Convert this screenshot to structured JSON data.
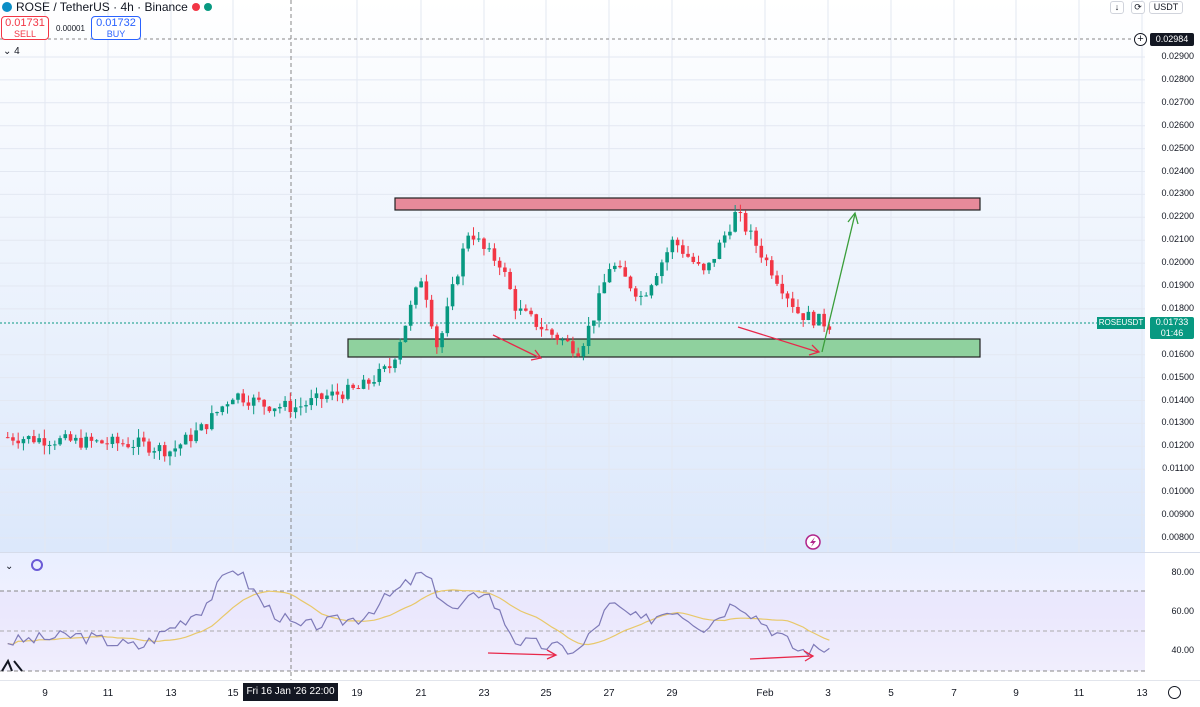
{
  "header": {
    "symbol": "ROSE / TetherUS · 4h · Binance",
    "sell_price": "0.01731",
    "sell_label": "SELL",
    "buy_price": "0.01732",
    "buy_label": "BUY",
    "spread": "0.00001",
    "indicator_count": "4",
    "currency_button": "USDT"
  },
  "price_axis": {
    "labels": [
      "0.02900",
      "0.02800",
      "0.02700",
      "0.02600",
      "0.02500",
      "0.02400",
      "0.02300",
      "0.02200",
      "0.02100",
      "0.02000",
      "0.01900",
      "0.01800",
      "0.01600",
      "0.01500",
      "0.01400",
      "0.01300",
      "0.01200",
      "0.01100",
      "0.01000",
      "0.00900",
      "0.00800"
    ],
    "top_price_tag": "0.02984",
    "last_price": "0.01733",
    "countdown": "01:46",
    "symbol_tag": "ROSEUSDT"
  },
  "rsi_axis": {
    "labels": [
      "80.00",
      "60.00",
      "40.00"
    ]
  },
  "time_axis": {
    "labels": [
      "9",
      "11",
      "13",
      "15",
      "19",
      "21",
      "23",
      "25",
      "27",
      "29",
      "Feb",
      "3",
      "5",
      "7",
      "9",
      "11",
      "13"
    ],
    "crosshair_label": "Fri 16 Jan '26   22:00"
  },
  "colors": {
    "up": "#089981",
    "down": "#f23645",
    "resistance_zone": "#e88a9a",
    "support_zone": "#8fd19e",
    "rsi_line": "#7e7ab8",
    "rsi_ma": "#e8c86a",
    "arrow_red": "#e8284a",
    "arrow_green": "#3a9e3a"
  },
  "chart_data": [
    {
      "type": "candlestick",
      "title": "ROSE / TetherUS · 4h · Binance",
      "ylim": [
        0.0078,
        0.03
      ],
      "approx_closes": [
        {
          "date": "Jan 7",
          "close": 0.0124
        },
        {
          "date": "Jan 9",
          "close": 0.0122
        },
        {
          "date": "Jan 11",
          "close": 0.0121
        },
        {
          "date": "Jan 12",
          "close": 0.0118
        },
        {
          "date": "Jan 13",
          "close": 0.0128
        },
        {
          "date": "Jan 14",
          "close": 0.0143
        },
        {
          "date": "Jan 15",
          "close": 0.0138
        },
        {
          "date": "Jan 16",
          "close": 0.0137
        },
        {
          "date": "Jan 17",
          "close": 0.0142
        },
        {
          "date": "Jan 18",
          "close": 0.0145
        },
        {
          "date": "Jan 19",
          "close": 0.0155
        },
        {
          "date": "Jan 20",
          "close": 0.0195
        },
        {
          "date": "Jan 20.5",
          "close": 0.0162
        },
        {
          "date": "Jan 21",
          "close": 0.019
        },
        {
          "date": "Jan 21.5",
          "close": 0.0215
        },
        {
          "date": "Jan 22",
          "close": 0.0205
        },
        {
          "date": "Jan 22.5",
          "close": 0.02
        },
        {
          "date": "Jan 23",
          "close": 0.018
        },
        {
          "date": "Jan 24",
          "close": 0.017
        },
        {
          "date": "Jan 25",
          "close": 0.0162
        },
        {
          "date": "Jan 25.5",
          "close": 0.0178
        },
        {
          "date": "Jan 26",
          "close": 0.02
        },
        {
          "date": "Jan 27",
          "close": 0.0185
        },
        {
          "date": "Jan 28",
          "close": 0.021
        },
        {
          "date": "Jan 29",
          "close": 0.0195
        },
        {
          "date": "Jan 30",
          "close": 0.0222
        },
        {
          "date": "Jan 31",
          "close": 0.02
        },
        {
          "date": "Feb 1",
          "close": 0.0178
        },
        {
          "date": "Feb 2",
          "close": 0.0173
        }
      ],
      "resistance_zone": [
        0.0222,
        0.0227
      ],
      "support_zone": [
        0.0158,
        0.0166
      ]
    },
    {
      "type": "line",
      "name": "RSI",
      "ylim": [
        30,
        85
      ],
      "levels": [
        70,
        50,
        30
      ],
      "approx_values": [
        {
          "date": "Jan 7",
          "rsi": 45
        },
        {
          "date": "Jan 9",
          "rsi": 48
        },
        {
          "date": "Jan 11",
          "rsi": 42
        },
        {
          "date": "Jan 13",
          "rsi": 62
        },
        {
          "date": "Jan 14",
          "rsi": 84
        },
        {
          "date": "Jan 15",
          "rsi": 63
        },
        {
          "date": "Jan 16",
          "rsi": 52
        },
        {
          "date": "Jan 18",
          "rsi": 57
        },
        {
          "date": "Jan 20",
          "rsi": 80
        },
        {
          "date": "Jan 21",
          "rsi": 60
        },
        {
          "date": "Jan 22",
          "rsi": 72
        },
        {
          "date": "Jan 23",
          "rsi": 45
        },
        {
          "date": "Jan 25",
          "rsi": 40
        },
        {
          "date": "Jan 26",
          "rsi": 64
        },
        {
          "date": "Jan 27",
          "rsi": 55
        },
        {
          "date": "Jan 28",
          "rsi": 62
        },
        {
          "date": "Jan 29",
          "rsi": 52
        },
        {
          "date": "Jan 30",
          "rsi": 66
        },
        {
          "date": "Feb 1",
          "rsi": 40
        },
        {
          "date": "Feb 2",
          "rsi": 42
        }
      ]
    }
  ]
}
